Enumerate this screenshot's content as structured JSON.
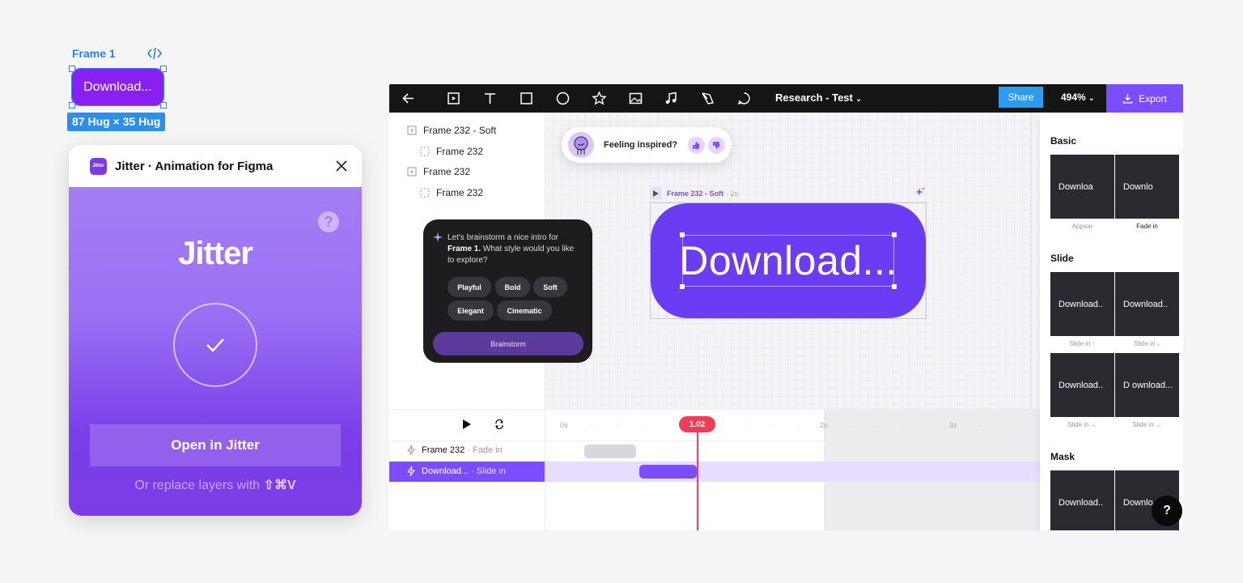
{
  "figma": {
    "frame_label": "Frame 1",
    "button_text": "Download...",
    "size_badge": "87 Hug × 35 Hug"
  },
  "plugin": {
    "logo_text": "Jitter",
    "title": "Jitter · Animation for Figma",
    "help": "?",
    "wordmark": "Jitter",
    "open_button": "Open in Jitter",
    "replace_prefix": "Or replace layers with",
    "replace_shortcut": "⇧⌘V"
  },
  "app": {
    "doc_title": "Research - Test",
    "share": "Share",
    "zoom": "494%",
    "export": "Export",
    "layers": [
      {
        "label": "Frame 232 - Soft"
      },
      {
        "label": "Frame 232"
      },
      {
        "label": "Frame 232"
      },
      {
        "label": "Frame 232"
      }
    ],
    "feeling": {
      "text": "Feeling inspired?"
    },
    "ai": {
      "line1": "Let's brainstorm a nice intro for",
      "bold": "Frame 1.",
      "line2": "What style would you like to explore?",
      "chips": [
        "Playful",
        "Bold",
        "Soft",
        "Elegant",
        "Cinematic"
      ],
      "brainstorm": "Brainstorm"
    },
    "frame_tag": {
      "name": "Frame 232 - Soft",
      "duration": "· 2s"
    },
    "big_button": "Download...",
    "panel": {
      "basic": "Basic",
      "slide": "Slide",
      "mask": "Mask",
      "basic_items": [
        {
          "preview": "Downloa",
          "caption": "Appear"
        },
        {
          "preview": "Downlo",
          "caption": "Fade in"
        }
      ],
      "slide_items": [
        {
          "preview": "Download..",
          "caption": "Slide in ↑"
        },
        {
          "preview": "Download..",
          "caption": "Slide in ↓"
        },
        {
          "preview": "Download..",
          "caption": "Slide in ←"
        },
        {
          "preview": "D ownload...",
          "caption": "Slide in →"
        }
      ],
      "mask_items": [
        {
          "preview": "Download.."
        },
        {
          "preview": "Downlo"
        }
      ]
    },
    "timeline": {
      "ticks": [
        "0s",
        "2s",
        "3s"
      ],
      "playhead": "1.02",
      "tracks": [
        {
          "name": "Frame 232",
          "anim": "· Fade in"
        },
        {
          "name": "Download...",
          "anim": "· Slide in"
        }
      ]
    },
    "help_fab": "?"
  },
  "colors": {
    "accent": "#7c4dff",
    "figma_blue": "#2f80ed",
    "playhead": "#ef3d5a",
    "button_purple": "#6a3df5"
  }
}
